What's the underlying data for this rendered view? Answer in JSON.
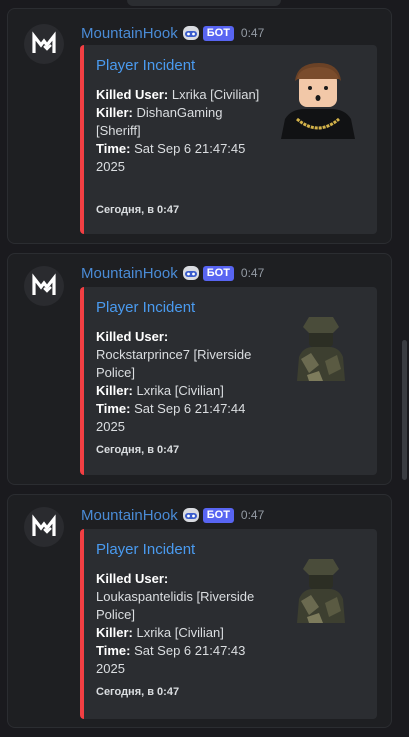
{
  "messages": [
    {
      "username": "MountainHook",
      "badge": "БОТ",
      "time": "0:47",
      "embed": {
        "title": "Player Incident",
        "killed_user_label": "Killed User:",
        "killed_user": "Lxrika [Civilian]",
        "killer_label": "Killer:",
        "killer": "DishanGaming [Sheriff]",
        "time_label": "Time:",
        "time": "Sat Sep 6 21:47:45 2025",
        "footer": "Сегодня, в 0:47",
        "color": "#f23f43"
      }
    },
    {
      "username": "MountainHook",
      "badge": "БОТ",
      "time": "0:47",
      "embed": {
        "title": "Player Incident",
        "killed_user_label": "Killed User:",
        "killed_user": "Rockstarprince7 [Riverside Police]",
        "killer_label": "Killer:",
        "killer": "Lxrika [Civilian]",
        "time_label": "Time:",
        "time": "Sat Sep 6 21:47:44 2025",
        "footer": "Сегодня, в 0:47",
        "color": "#f23f43"
      }
    },
    {
      "username": "MountainHook",
      "badge": "БОТ",
      "time": "0:47",
      "embed": {
        "title": "Player Incident",
        "killed_user_label": "Killed User:",
        "killed_user": "Loukaspantelidis [Riverside Police]",
        "killer_label": "Killer:",
        "killer": "Lxrika [Civilian]",
        "time_label": "Time:",
        "time": "Sat Sep 6 21:47:43 2025",
        "footer": "Сегодня, в 0:47",
        "color": "#f23f43"
      }
    }
  ],
  "colors": {
    "username": "#4a8bd6",
    "badge": "#5865f2",
    "embed_title": "#4a9bf0",
    "embed_border": "#f23f43"
  }
}
